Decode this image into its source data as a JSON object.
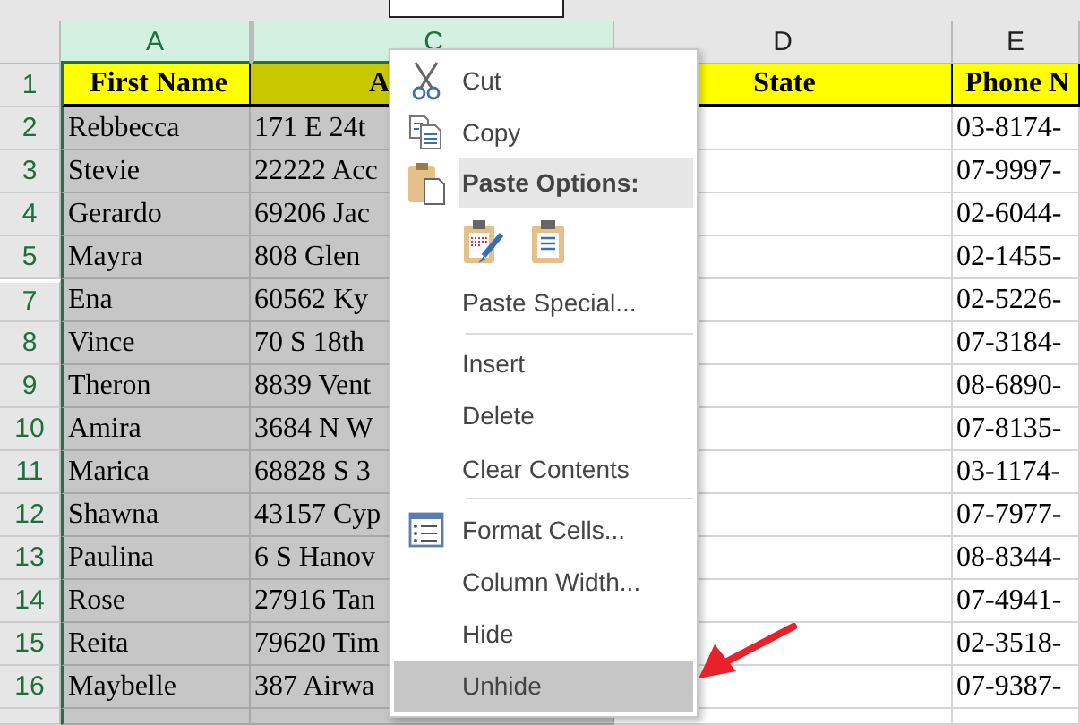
{
  "sheet": {
    "columns": [
      {
        "letter": "A",
        "selected": true,
        "hidden_before": false
      },
      {
        "letter": "C",
        "selected": true,
        "hidden_before": true
      },
      {
        "letter": "D",
        "selected": false,
        "hidden_before": false
      },
      {
        "letter": "E",
        "selected": false,
        "hidden_before": false
      }
    ],
    "rows": [
      {
        "number": "1",
        "kind": "header",
        "hidden_before": false,
        "cells": [
          "First Name",
          "A",
          "State",
          "Phone N"
        ]
      },
      {
        "number": "2",
        "kind": "data",
        "hidden_before": false,
        "cells": [
          "Rebbecca",
          "171 E 24t",
          "",
          "03-8174-"
        ]
      },
      {
        "number": "3",
        "kind": "data",
        "hidden_before": false,
        "cells": [
          "Stevie",
          "22222 Acc",
          "",
          "07-9997-"
        ]
      },
      {
        "number": "4",
        "kind": "data",
        "hidden_before": false,
        "cells": [
          "Gerardo",
          "69206 Jac",
          "",
          "02-6044-"
        ]
      },
      {
        "number": "5",
        "kind": "data",
        "hidden_before": false,
        "cells": [
          "Mayra",
          "808 Glen",
          "",
          "02-1455-"
        ]
      },
      {
        "number": "7",
        "kind": "data",
        "hidden_before": true,
        "cells": [
          "Ena",
          "60562 Ky",
          "",
          "02-5226-"
        ]
      },
      {
        "number": "8",
        "kind": "data",
        "hidden_before": false,
        "cells": [
          "Vince",
          "70 S 18th",
          "",
          "07-3184-"
        ]
      },
      {
        "number": "9",
        "kind": "data",
        "hidden_before": false,
        "cells": [
          "Theron",
          "8839 Vent",
          "",
          "08-6890-"
        ]
      },
      {
        "number": "10",
        "kind": "data",
        "hidden_before": false,
        "cells": [
          "Amira",
          "3684 N W",
          "",
          "07-8135-"
        ]
      },
      {
        "number": "11",
        "kind": "data",
        "hidden_before": false,
        "cells": [
          "Marica",
          "68828 S 3",
          "",
          "03-1174-"
        ]
      },
      {
        "number": "12",
        "kind": "data",
        "hidden_before": false,
        "cells": [
          "Shawna",
          "43157 Cyp",
          "",
          "07-7977-"
        ]
      },
      {
        "number": "13",
        "kind": "data",
        "hidden_before": false,
        "cells": [
          "Paulina",
          "6 S Hanov",
          "",
          "08-8344-"
        ]
      },
      {
        "number": "14",
        "kind": "data",
        "hidden_before": false,
        "cells": [
          "Rose",
          "27916 Tan",
          "",
          "07-4941-"
        ]
      },
      {
        "number": "15",
        "kind": "data",
        "hidden_before": false,
        "cells": [
          "Reita",
          "79620 Tim",
          "",
          "02-3518-"
        ]
      },
      {
        "number": "16",
        "kind": "data",
        "hidden_before": false,
        "cells": [
          "Maybelle",
          "387 Airwa",
          "",
          "07-9387-"
        ]
      }
    ]
  },
  "context_menu": {
    "items": [
      {
        "kind": "action",
        "label": "Cut",
        "selected": false
      },
      {
        "kind": "action",
        "label": "Copy",
        "selected": false
      },
      {
        "kind": "header",
        "label": "Paste Options:"
      },
      {
        "kind": "paste_options"
      },
      {
        "kind": "action",
        "label": "Paste Special...",
        "selected": false
      },
      {
        "kind": "separator"
      },
      {
        "kind": "action",
        "label": "Insert",
        "selected": false
      },
      {
        "kind": "action",
        "label": "Delete",
        "selected": false
      },
      {
        "kind": "action",
        "label": "Clear Contents",
        "selected": false
      },
      {
        "kind": "separator"
      },
      {
        "kind": "action",
        "label": "Format Cells...",
        "selected": false
      },
      {
        "kind": "action",
        "label": "Column Width...",
        "selected": false
      },
      {
        "kind": "action",
        "label": "Hide",
        "selected": false
      },
      {
        "kind": "action",
        "label": "Unhide",
        "selected": true
      }
    ]
  }
}
